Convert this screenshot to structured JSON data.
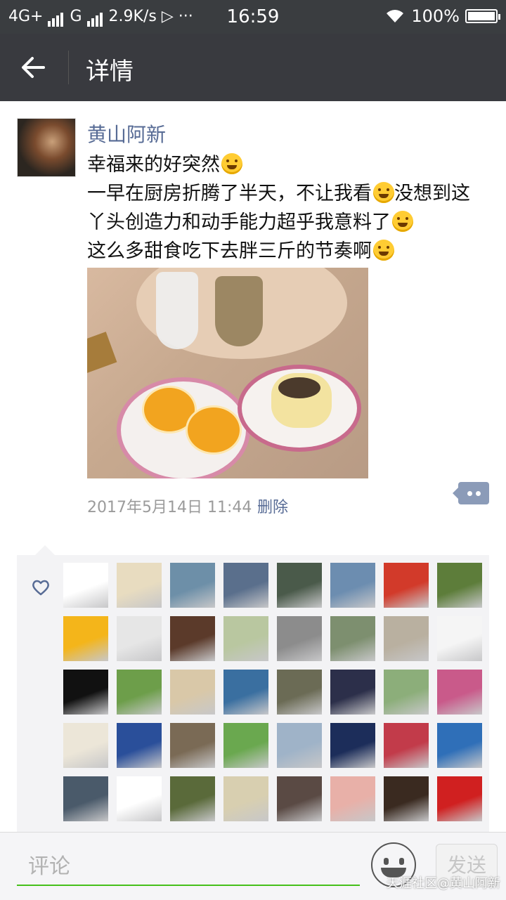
{
  "status_bar": {
    "network_left": "4G+",
    "network_right": "G",
    "speed": "2.9K/s",
    "more": "···",
    "time": "16:59",
    "battery": "100%",
    "battery_level": 1.0
  },
  "header": {
    "title": "详情"
  },
  "post": {
    "author": "黄山阿新",
    "lines": [
      "幸福来的好突然",
      "一早在厨房折腾了半天，不让我看",
      "没想到这",
      "丫头创造力和动手能力超乎我意料了",
      "这么多甜食吃下去胖三斤的节奏啊"
    ],
    "emojis": [
      "laughing-tears-emoji",
      "laughing-tears-emoji",
      "thinking-emoji",
      "rolling-laugh-emoji"
    ],
    "timestamp": "2017年5月14日 11:44",
    "delete_label": "删除"
  },
  "likes": {
    "icon": "heart-icon",
    "avatar_colors": [
      [
        "#ffffff",
        "#e8dcc0",
        "#6d8fa8",
        "#5a6f8c",
        "#4a5a4a",
        "#6c8db0",
        "#d23a2a",
        "#5d7d3a"
      ],
      [
        "#f4b51a",
        "#e6e6e6",
        "#5b3a2a",
        "#b9c7a0",
        "#8c8c8c",
        "#7d8f6f",
        "#b9b0a0",
        "#f5f5f5"
      ],
      [
        "#111111",
        "#6d9e4a",
        "#d9c8a8",
        "#3a6fa0",
        "#6b6b55",
        "#2c2f4a",
        "#8cae7a",
        "#c95a8a"
      ],
      [
        "#ece6d8",
        "#2a4f9a",
        "#7a6a55",
        "#6aa84f",
        "#9fb3c8",
        "#1c2d5a",
        "#c23b4a",
        "#2f6fb8"
      ],
      [
        "#4a5a6a",
        "#ffffff",
        "#5a6a3a",
        "#d8cfb0",
        "#5a4a44",
        "#e8b0a8",
        "#3a2a20",
        "#d02020"
      ]
    ],
    "avatar_names": [
      [
        "avatar-logo",
        "avatar-duck",
        "avatar-uniform",
        "avatar-landscape",
        "avatar-man",
        "avatar-towers",
        "avatar-flower",
        "avatar-plant"
      ],
      [
        "avatar-pooh",
        "avatar-sketch",
        "avatar-silhouette",
        "avatar-plaza",
        "avatar-car",
        "avatar-path",
        "avatar-beach",
        "avatar-panda"
      ],
      [
        "avatar-prism",
        "avatar-girl-track",
        "avatar-cartoon",
        "avatar-lake",
        "avatar-building",
        "avatar-sunset",
        "avatar-girl",
        "avatar-lady"
      ],
      [
        "avatar-dancer",
        "avatar-fantasy",
        "avatar-woman",
        "avatar-lotus",
        "avatar-suit-man",
        "avatar-night-city",
        "avatar-red-flower",
        "avatar-sea"
      ],
      [
        "avatar-couple",
        "avatar-kid",
        "avatar-men",
        "avatar-ink-painting",
        "avatar-woman-2",
        "avatar-blossom",
        "avatar-family",
        "avatar-brands"
      ]
    ]
  },
  "comment_bar": {
    "placeholder": "评论",
    "send_label": "发送"
  },
  "watermark": "天涯社区@黄山阿新"
}
